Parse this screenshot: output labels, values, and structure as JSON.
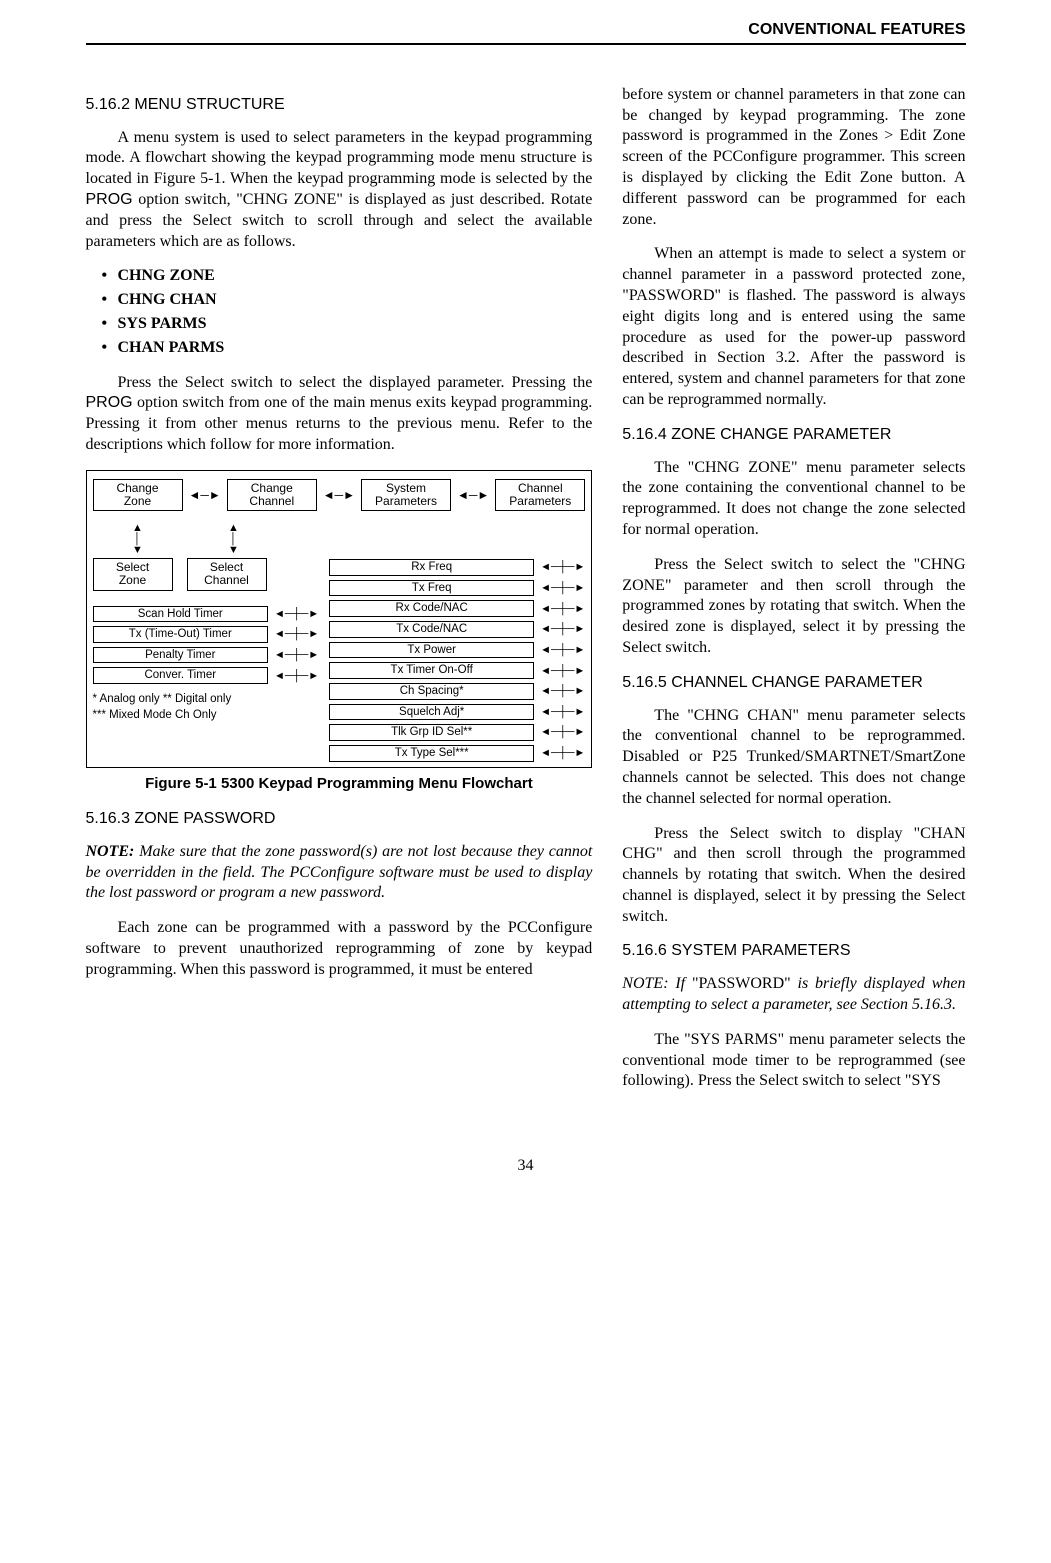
{
  "header": {
    "title": "CONVENTIONAL FEATURES"
  },
  "left": {
    "s5162": {
      "heading": "5.16.2  MENU STRUCTURE",
      "p1a": "A menu system is used to select parameters in the keypad programming mode. A flowchart showing the keypad programming mode menu structure is located in Figure 5-1. When the keypad programming mode is selected by the ",
      "prog1": "PROG",
      "p1b": " option switch, \"CHNG ZONE\" is displayed as just described. Rotate and press the Select switch to scroll through and select the available parameters which are as follows.",
      "bullets": [
        "CHNG ZONE",
        "CHNG CHAN",
        "SYS PARMS",
        "CHAN PARMS"
      ],
      "p2a": "Press the Select switch to select the displayed parameter. Pressing the ",
      "prog2": "PROG",
      "p2b": " option switch from one of the main menus exits keypad programming. Pressing it from other menus returns to the previous menu. Refer to the descriptions which follow for more information."
    },
    "figure": {
      "top": [
        "Change\nZone",
        "Change\nChannel",
        "System\nParameters",
        "Channel\nParameters"
      ],
      "selects": [
        "Select\nZone",
        "Select\nChannel"
      ],
      "sys_params": [
        "Scan Hold Timer",
        "Tx (Time-Out) Timer",
        "Penalty Timer",
        "Conver. Timer"
      ],
      "chan_params": [
        "Rx Freq",
        "Tx Freq",
        "Rx Code/NAC",
        "Tx Code/NAC",
        "Tx Power",
        "Tx Timer On-Off",
        "Ch Spacing*",
        "Squelch Adj*",
        "Tlk Grp ID Sel**",
        "Tx Type Sel***"
      ],
      "legend1": "* Analog only      ** Digital only",
      "legend2": "*** Mixed Mode Ch Only",
      "caption": "Figure 5-1   5300 Keypad Programming Menu Flowchart"
    },
    "s5163": {
      "heading": "5.16.3  ZONE PASSWORD",
      "note_label": "NOTE:",
      "note": " Make sure that the zone password(s) are not lost because they cannot be overridden in the field. The PCConfigure software must be used to display the lost password or program a new password.",
      "p1": "Each zone can be programmed with a password by the PCConfigure software to prevent unauthorized reprogramming of zone by keypad programming. When this password is programmed, it must be entered"
    }
  },
  "right": {
    "p_cont1": "before system or channel parameters in that zone can be changed by keypad programming. The zone password is programmed in the Zones > Edit Zone screen of the PCConfigure programmer. This screen is displayed by clicking the Edit Zone button. A different password can be programmed for each zone.",
    "p_cont2": "When an attempt is made to select a system or channel parameter in a password protected zone, \"PASSWORD\" is flashed. The password is always eight digits long and is entered using the same procedure as used for the power-up password described in Section 3.2. After the password is entered, system and channel parameters for that zone can be reprogrammed normally.",
    "s5164": {
      "heading": "5.16.4  ZONE CHANGE PARAMETER",
      "p1": "The \"CHNG ZONE\" menu parameter selects the zone containing the conventional channel to be reprogrammed. It does not change the zone selected for normal operation.",
      "p2": "Press the Select switch to select the \"CHNG ZONE\" parameter and then scroll through the programmed zones by rotating that switch. When the desired zone is displayed, select it by pressing the Select switch."
    },
    "s5165": {
      "heading": "5.16.5  CHANNEL CHANGE PARAMETER",
      "p1": "The \"CHNG CHAN\" menu parameter selects the conventional channel to be reprogrammed. Disabled or P25 Trunked/SMARTNET/SmartZone channels cannot be selected. This does not change the channel selected for normal operation.",
      "p2": "Press the Select switch to display \"CHAN CHG\" and then scroll through the programmed channels by rotating that switch. When the desired channel is displayed, select it by pressing the Select switch."
    },
    "s5166": {
      "heading": "5.16.6  SYSTEM PARAMETERS",
      "note_label": "NOTE: If ",
      "note_mid": "\"PASSWORD\"",
      "note_end": " is briefly displayed when attempting to select a parameter, see Section 5.16.3.",
      "p1": "The \"SYS PARMS\" menu parameter selects the conventional mode timer to be reprogrammed (see following). Press the Select switch to select \"SYS"
    }
  },
  "page_number": "34"
}
